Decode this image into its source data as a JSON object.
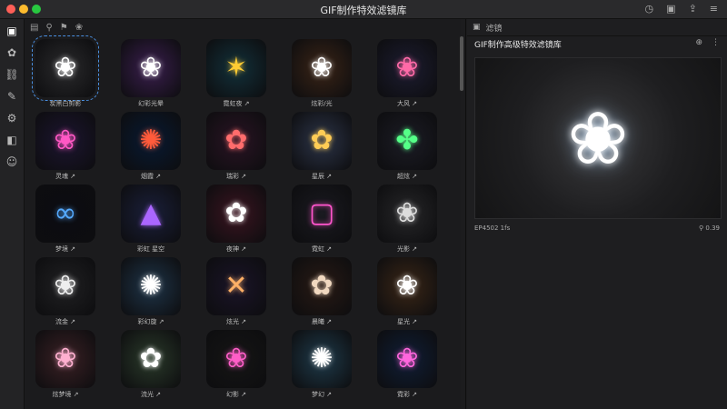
{
  "window": {
    "title": "GIF制作特效滤镜库"
  },
  "titlebar_icons": [
    "clock-icon",
    "picture-icon",
    "share-icon",
    "menu-icon"
  ],
  "rail": {
    "items": [
      {
        "name": "rail-item-photo",
        "icon": "▣"
      },
      {
        "name": "rail-item-effects",
        "icon": "✿"
      },
      {
        "name": "rail-item-link",
        "icon": "⛓"
      },
      {
        "name": "rail-item-pen",
        "icon": "✎"
      },
      {
        "name": "rail-item-tune",
        "icon": "⚙"
      },
      {
        "name": "rail-item-layers",
        "icon": "◧"
      },
      {
        "name": "rail-item-people",
        "icon": "☺"
      }
    ]
  },
  "gallery_toolbar": {
    "icons": [
      "▤",
      "⚲",
      "⚑",
      "❀"
    ]
  },
  "tiles": [
    {
      "caption": "炭黑白剪影",
      "color": "#ffffff",
      "bg": "#2a2a2c",
      "glyph": "❀"
    },
    {
      "caption": "幻彩光晕",
      "color": "#ffffff",
      "bg": "#3a1e4e",
      "glyph": "❀"
    },
    {
      "caption": "霓虹夜 ↗",
      "color": "#ffcc33",
      "bg": "#12303a",
      "glyph": "✶"
    },
    {
      "caption": "炫彩/光",
      "color": "#ffffff",
      "bg": "#3a2416",
      "glyph": "❀"
    },
    {
      "caption": "大风 ↗",
      "color": "#ff6aa8",
      "bg": "#1c1c30",
      "glyph": "❀"
    },
    {
      "caption": "灵魂 ↗",
      "color": "#ff58c4",
      "bg": "#1c1530",
      "glyph": "❀"
    },
    {
      "caption": "烟霞 ↗",
      "color": "#ff5b3b",
      "bg": "#081a33",
      "glyph": "✺"
    },
    {
      "caption": "瑞彩 ↗",
      "color": "#ff6c6c",
      "bg": "#2a1424",
      "glyph": "✿"
    },
    {
      "caption": "星辰 ↗",
      "color": "#ffcc55",
      "bg": "#2c3448",
      "glyph": "✿"
    },
    {
      "caption": "超炫 ↗",
      "color": "#55ff88",
      "bg": "#1c1c25",
      "glyph": "✤"
    },
    {
      "caption": "梦境 ↗",
      "color": "#55aaff",
      "bg": "#0c0c12",
      "glyph": "∞"
    },
    {
      "caption": "彩虹 星空",
      "color": "#aa66ff",
      "bg": "#1a1f3a",
      "glyph": "▲"
    },
    {
      "caption": "夜神 ↗",
      "color": "#ffffff",
      "bg": "#3a1420",
      "glyph": "✿"
    },
    {
      "caption": "霓虹 ↗",
      "color": "#ff55cc",
      "bg": "#1a1a20",
      "glyph": "▢"
    },
    {
      "caption": "光影 ↗",
      "color": "#dddddd",
      "bg": "#262628",
      "glyph": "❀"
    },
    {
      "caption": "流金 ↗",
      "color": "#eeeeee",
      "bg": "#202022",
      "glyph": "❀"
    },
    {
      "caption": "彩幻旋 ↗",
      "color": "#ffffff",
      "bg": "#1e3448",
      "glyph": "✺"
    },
    {
      "caption": "炫光 ↗",
      "color": "#ffb066",
      "bg": "#1a1428",
      "glyph": "✕"
    },
    {
      "caption": "晨曦 ↗",
      "color": "#f0d8c0",
      "bg": "#281a14",
      "glyph": "✿"
    },
    {
      "caption": "星光 ↗",
      "color": "#ffffff",
      "bg": "#3a2616",
      "glyph": "❀"
    },
    {
      "caption": "炫梦境 ↗",
      "color": "#ffb0d0",
      "bg": "#3a2024",
      "glyph": "❀"
    },
    {
      "caption": "流光 ↗",
      "color": "#ffffff",
      "bg": "#2a3a2a",
      "glyph": "✿"
    },
    {
      "caption": "幻影 ↗",
      "color": "#ff5ec8",
      "bg": "#151515",
      "glyph": "❀"
    },
    {
      "caption": "梦幻 ↗",
      "color": "#ffffff",
      "bg": "#1e3a4a",
      "glyph": "✺"
    },
    {
      "caption": "霓彩 ↗",
      "color": "#ff66dd",
      "bg": "#101e36",
      "glyph": "❀"
    }
  ],
  "panel": {
    "tabs": [
      "▣",
      "滤镜"
    ],
    "title": "GIF制作高级特效滤镜库",
    "icons": [
      "⊕",
      "⋮"
    ],
    "preview_glyph": "❀",
    "info": "EP4502 1fs",
    "zoom": "⚲ 0.39"
  }
}
